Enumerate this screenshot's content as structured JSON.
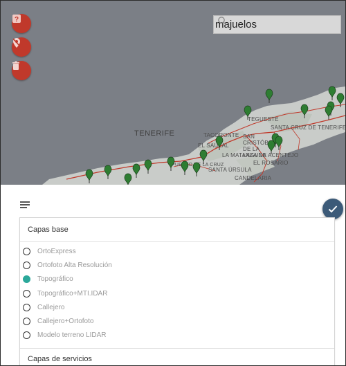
{
  "colors": {
    "map_water": "#7b7f86",
    "land": "#c9ccc9",
    "road": "#c0392b",
    "marker": "#2e7d32",
    "control_button": "#c0392b",
    "confirm_button": "#3c5a78",
    "selected_radio": "#2ba89a"
  },
  "map": {
    "labels": [
      "TENERIFE",
      "TEGUESTE",
      "SANTA CRUZ DE TENERIFE",
      "TACORONTE",
      "SAN CRISTÓBAL DE LA LAGUNA",
      "EL SAUZAL",
      "LA MATANZA DE ACENTEJO",
      "EL ROSARIO",
      "PUERTO DE LA CRUZ",
      "SANTA ÚRSULA",
      "CANDELARIA"
    ],
    "controls": {
      "help_icon": "help-icon",
      "location_off_icon": "location-off-icon",
      "delete_icon": "trash-icon"
    },
    "search": {
      "value": "majuelos",
      "icon": "search-icon"
    }
  },
  "panel": {
    "menu_icon": "menu-icon",
    "confirm_icon": "check-icon",
    "base_layers_title": "Capas base",
    "base_layers": [
      {
        "label": "OrtoExpress",
        "selected": false
      },
      {
        "label": "Ortofoto Alta Resolución",
        "selected": false
      },
      {
        "label": "Topográfico",
        "selected": true
      },
      {
        "label": "Topográfico+MTI.IDAR",
        "selected": false
      },
      {
        "label": "Callejero",
        "selected": false
      },
      {
        "label": "Callejero+Ortofoto",
        "selected": false
      },
      {
        "label": "Modelo terreno LIDAR",
        "selected": false
      }
    ],
    "service_layers_title": "Capas de servicios"
  }
}
